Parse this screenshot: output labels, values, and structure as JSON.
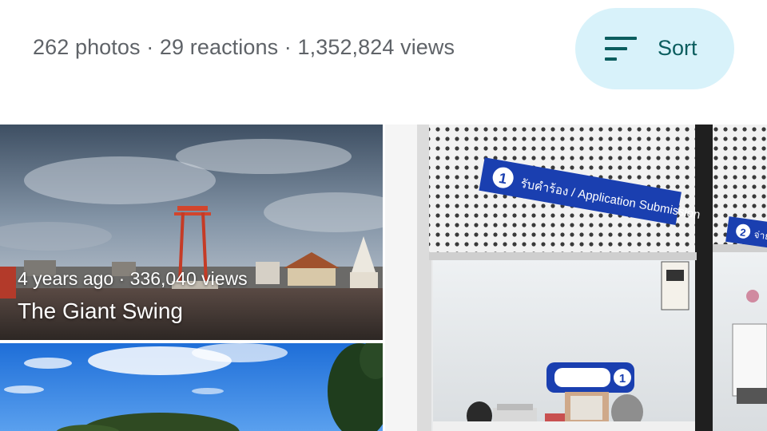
{
  "header": {
    "stats_text": "262 photos · 29 reactions · 1,352,824 views",
    "sort_label": "Sort",
    "sort_icon": "sort-lines-icon"
  },
  "photos": [
    {
      "meta": "4 years ago · 336,040 views",
      "title": "The Giant Swing",
      "sign_number": "",
      "sign_text": ""
    },
    {
      "meta": "",
      "title": ""
    },
    {
      "sign_number": "1",
      "sign_text": "รับคำร้อง / Application Submission",
      "sign2_number": "2",
      "sign2_text": "จ่าย",
      "counter_number": "1"
    }
  ],
  "colors": {
    "sort_bg": "#d8f2fa",
    "sort_fg": "#0b5d5e",
    "stats_text": "#5f6368"
  }
}
